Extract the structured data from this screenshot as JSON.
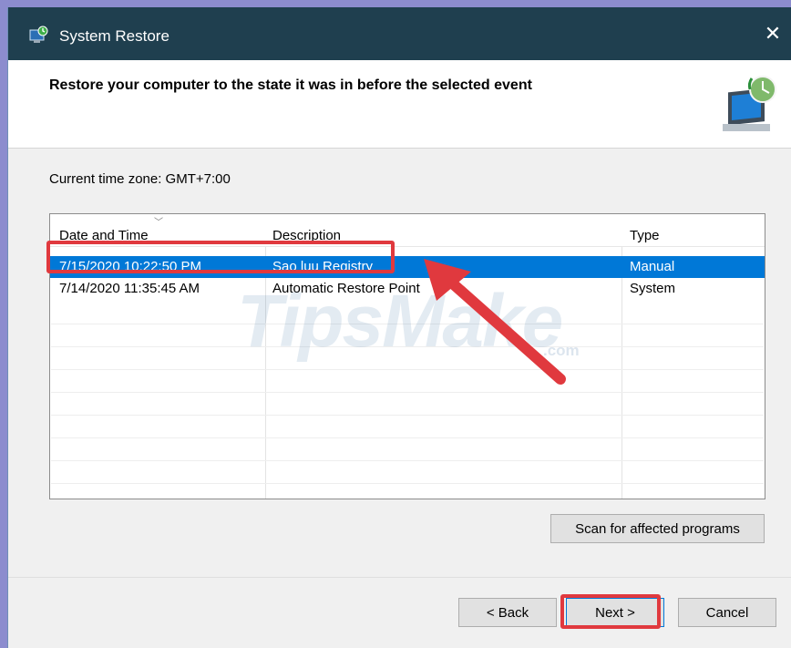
{
  "window": {
    "title": "System Restore",
    "close_glyph": "✕",
    "app_icon": "system-restore-icon"
  },
  "header": {
    "heading": "Restore your computer to the state it was in before the selected event",
    "icon": "restore-monitor-icon"
  },
  "timezone": "Current time zone: GMT+7:00",
  "table": {
    "columns": [
      "Date and Time",
      "Description",
      "Type"
    ],
    "rows": [
      {
        "date": "7/15/2020 10:22:50 PM",
        "description": "Sao luu Registry",
        "type": "Manual",
        "selected": true
      },
      {
        "date": "7/14/2020 11:35:45 AM",
        "description": "Automatic Restore Point",
        "type": "System",
        "selected": false
      }
    ]
  },
  "buttons": {
    "scan": "Scan for affected programs",
    "back": "< Back",
    "next": "Next >",
    "cancel": "Cancel"
  },
  "watermark": {
    "main": "TipsMake",
    "suffix": ".com"
  },
  "colors": {
    "titlebar": "#1f3f4f",
    "selection": "#0078d7",
    "annotation": "#e0393e"
  }
}
